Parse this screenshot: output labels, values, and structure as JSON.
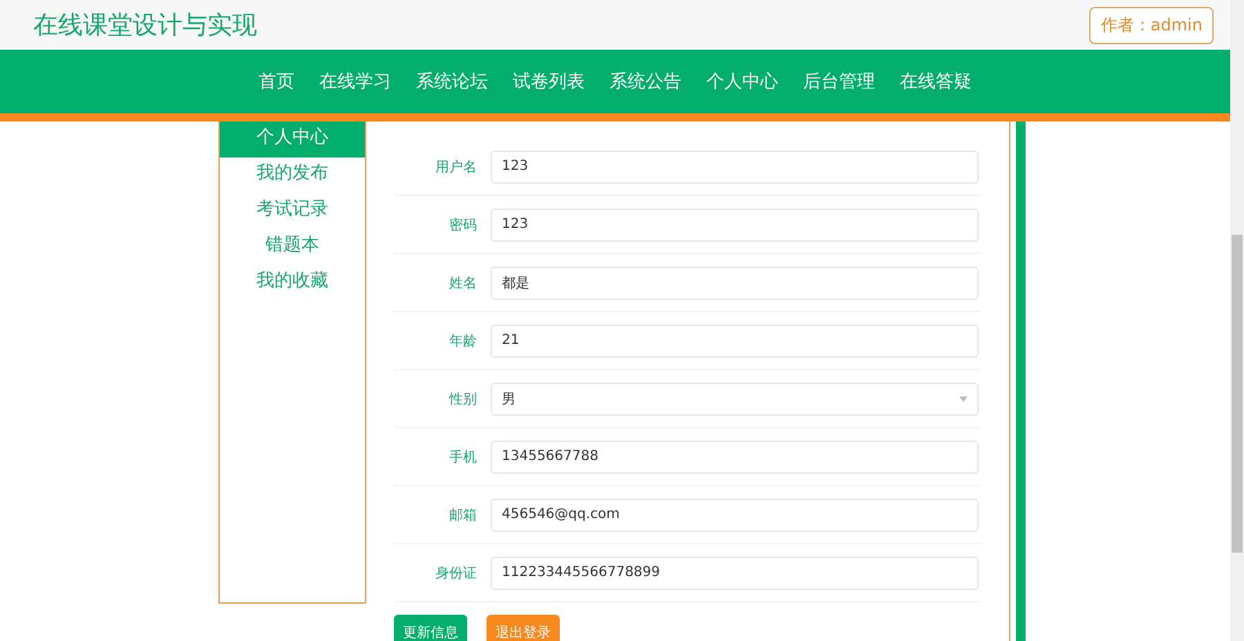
{
  "header": {
    "title": "在线课堂设计与实现",
    "author_button": "作者：admin"
  },
  "nav": [
    {
      "label": "首页"
    },
    {
      "label": "在线学习"
    },
    {
      "label": "系统论坛"
    },
    {
      "label": "试卷列表"
    },
    {
      "label": "系统公告"
    },
    {
      "label": "个人中心"
    },
    {
      "label": "后台管理"
    },
    {
      "label": "在线答疑"
    }
  ],
  "sidebar": [
    {
      "label": "个人中心",
      "selected": true
    },
    {
      "label": "我的发布",
      "selected": false
    },
    {
      "label": "考试记录",
      "selected": false
    },
    {
      "label": "错题本",
      "selected": false
    },
    {
      "label": "我的收藏",
      "selected": false
    }
  ],
  "form": {
    "fields": [
      {
        "label": "用户名",
        "kind": "text",
        "value": "123"
      },
      {
        "label": "密码",
        "kind": "text",
        "value": "123"
      },
      {
        "label": "姓名",
        "kind": "text",
        "value": "都是"
      },
      {
        "label": "年龄",
        "kind": "text",
        "value": "21"
      },
      {
        "label": "性别",
        "kind": "select",
        "value": "男"
      },
      {
        "label": "手机",
        "kind": "text",
        "value": "13455667788"
      },
      {
        "label": "邮箱",
        "kind": "text",
        "value": "456546@qq.com"
      },
      {
        "label": "身份证",
        "kind": "text",
        "value": "112233445566778899"
      }
    ],
    "buttons": [
      {
        "label": "更新信息",
        "kind": "primary"
      },
      {
        "label": "退出登录",
        "kind": "warning"
      }
    ]
  }
}
